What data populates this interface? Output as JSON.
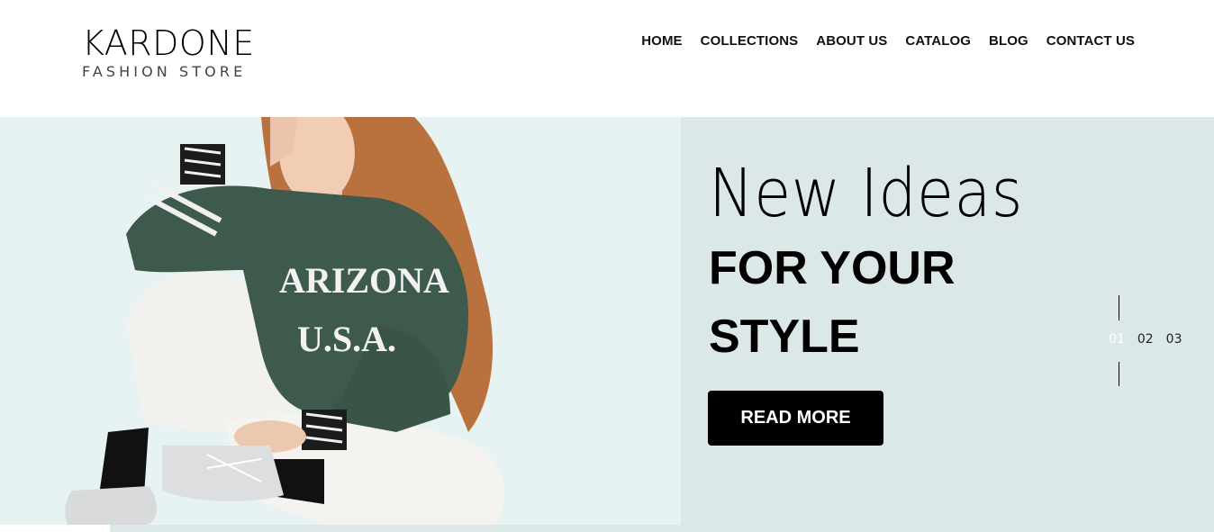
{
  "brand": {
    "name": "KARDONE",
    "tagline": "FASHION STORE"
  },
  "nav": {
    "items": [
      "HOME",
      "COLLECTIONS",
      "ABOUT US",
      "CATALOG",
      "BLOG",
      "CONTACT US"
    ]
  },
  "hero": {
    "headline_light": "New Ideas",
    "headline_bold_1": "FOR YOUR",
    "headline_bold_2": "STYLE",
    "cta_label": "READ MORE",
    "image_text_1": "ARIZONA",
    "image_text_2": "U.S.A.",
    "slides": [
      "01",
      "02",
      "03"
    ],
    "active_slide": "01"
  },
  "colors": {
    "hero_bg": "#dce7e8",
    "image_bg": "#e7f2f2",
    "sweater": "#3e5a4c",
    "button": "#000000"
  }
}
